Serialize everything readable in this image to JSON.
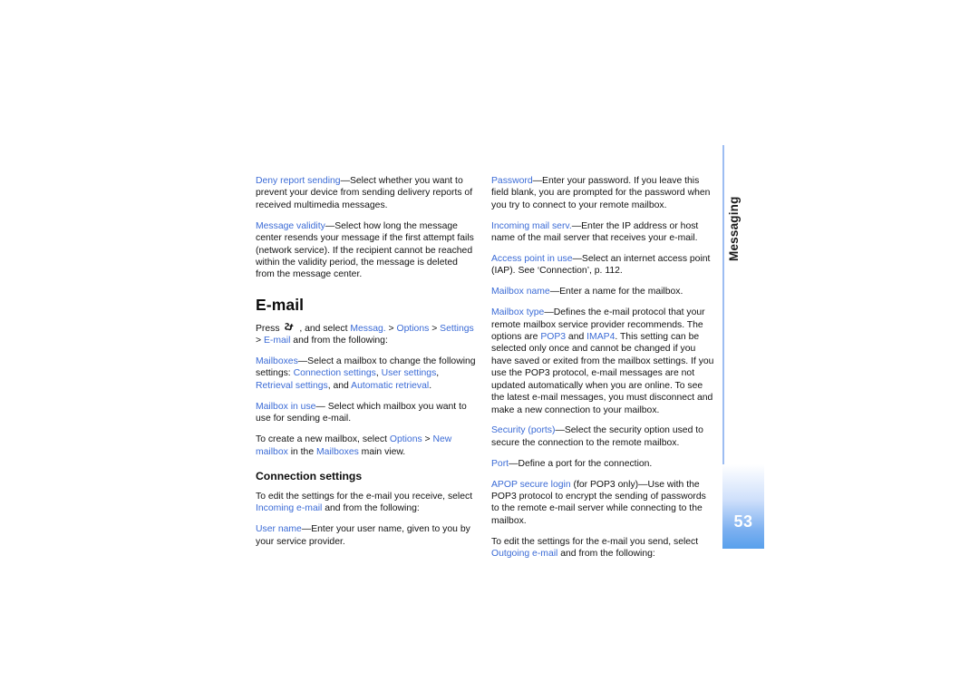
{
  "page": {
    "number": "53",
    "chapter_label": "Messaging",
    "accent_color": "#3b6bd6",
    "tab_color": "#58a0ec"
  },
  "left_column": {
    "paragraphs": [
      {
        "id": "deny-report-sending",
        "runs": [
          {
            "text": "Deny report sending",
            "link": true
          },
          {
            "text": "—Select whether you want to prevent your device from sending delivery reports of received multimedia messages.",
            "link": false
          }
        ]
      },
      {
        "id": "message-validity",
        "runs": [
          {
            "text": "Message validity",
            "link": true
          },
          {
            "text": "—Select how long the message center resends your message if the first attempt fails (network service). If the recipient cannot be reached within the validity period, the message is deleted from the message center.",
            "link": false
          }
        ]
      }
    ],
    "section_title": "E-mail",
    "after_title_paragraphs": [
      {
        "id": "press-path",
        "icon": "menu-key-icon",
        "runs": [
          {
            "text": "Press ",
            "link": false
          },
          {
            "icon": "menu-key-icon"
          },
          {
            "text": " , and select ",
            "link": false
          },
          {
            "text": "Messag.",
            "link": true
          },
          {
            "text": " > ",
            "link": false
          },
          {
            "text": "Options",
            "link": true
          },
          {
            "text": " > ",
            "link": false
          },
          {
            "text": "Settings",
            "link": true
          },
          {
            "text": " > ",
            "link": false
          },
          {
            "text": "E-mail",
            "link": true
          },
          {
            "text": " and from the following:",
            "link": false
          }
        ]
      },
      {
        "id": "mailboxes",
        "runs": [
          {
            "text": "Mailboxes",
            "link": true
          },
          {
            "text": "—Select a mailbox to change the following settings: ",
            "link": false
          },
          {
            "text": "Connection settings",
            "link": true
          },
          {
            "text": ", ",
            "link": false
          },
          {
            "text": "User settings",
            "link": true
          },
          {
            "text": ", ",
            "link": false
          },
          {
            "text": "Retrieval settings",
            "link": true
          },
          {
            "text": ", and ",
            "link": false
          },
          {
            "text": "Automatic retrieval",
            "link": true
          },
          {
            "text": ".",
            "link": false
          }
        ]
      },
      {
        "id": "mailbox-in-use",
        "runs": [
          {
            "text": "Mailbox in use",
            "link": true
          },
          {
            "text": "— Select which mailbox you want to use for sending e-mail.",
            "link": false
          }
        ]
      },
      {
        "id": "create-new-mailbox",
        "runs": [
          {
            "text": "To create a new mailbox, select ",
            "link": false
          },
          {
            "text": "Options",
            "link": true
          },
          {
            "text": " > ",
            "link": false
          },
          {
            "text": "New mailbox",
            "link": true
          },
          {
            "text": " in the ",
            "link": false
          },
          {
            "text": "Mailboxes",
            "link": true
          },
          {
            "text": " main view.",
            "link": false
          }
        ]
      }
    ],
    "sub_title": "Connection settings",
    "after_sub_paragraphs": [
      {
        "id": "incoming-email-intro",
        "runs": [
          {
            "text": "To edit the settings for the e-mail you receive, select ",
            "link": false
          },
          {
            "text": "Incoming e-mail",
            "link": true
          },
          {
            "text": " and from the following:",
            "link": false
          }
        ]
      },
      {
        "id": "user-name",
        "runs": [
          {
            "text": "User name",
            "link": true
          },
          {
            "text": "—Enter your user name, given to you by your service provider.",
            "link": false
          }
        ]
      }
    ]
  },
  "right_column": {
    "paragraphs": [
      {
        "id": "password",
        "runs": [
          {
            "text": "Password",
            "link": true
          },
          {
            "text": "—Enter your password. If you leave this field blank, you are prompted for the password when you try to connect to your remote mailbox.",
            "link": false
          }
        ]
      },
      {
        "id": "incoming-mail-serv",
        "runs": [
          {
            "text": "Incoming mail serv.",
            "link": true
          },
          {
            "text": "—Enter the IP address or host name of the mail server that receives your e-mail.",
            "link": false
          }
        ]
      },
      {
        "id": "access-point-in-use",
        "runs": [
          {
            "text": "Access point in use",
            "link": true
          },
          {
            "text": "—Select an internet access point (IAP). See ‘Connection’, p. 112.",
            "link": false
          }
        ]
      },
      {
        "id": "mailbox-name",
        "runs": [
          {
            "text": "Mailbox name",
            "link": true
          },
          {
            "text": "—Enter a name for the mailbox.",
            "link": false
          }
        ]
      },
      {
        "id": "mailbox-type",
        "runs": [
          {
            "text": "Mailbox type",
            "link": true
          },
          {
            "text": "—Defines the e-mail protocol that your remote mailbox service provider recommends. The options are ",
            "link": false
          },
          {
            "text": "POP3",
            "link": true
          },
          {
            "text": " and ",
            "link": false
          },
          {
            "text": "IMAP4",
            "link": true
          },
          {
            "text": ". This setting can be selected only once and cannot be changed if you have saved or exited from the mailbox settings. If you use the POP3 protocol, e-mail messages are not updated automatically when you are online. To see the latest e-mail messages, you must disconnect and make a new connection to your mailbox.",
            "link": false
          }
        ]
      },
      {
        "id": "security-ports",
        "runs": [
          {
            "text": "Security (ports)",
            "link": true
          },
          {
            "text": "—Select the security option used to secure the connection to the remote mailbox.",
            "link": false
          }
        ]
      },
      {
        "id": "port",
        "runs": [
          {
            "text": "Port",
            "link": true
          },
          {
            "text": "—Define a port for the connection.",
            "link": false
          }
        ]
      },
      {
        "id": "apop-secure-login",
        "runs": [
          {
            "text": "APOP secure login",
            "link": true
          },
          {
            "text": " (for POP3 only)—Use with the POP3 protocol to encrypt the sending of passwords to the remote e-mail server while connecting to the mailbox.",
            "link": false
          }
        ]
      },
      {
        "id": "outgoing-email-intro",
        "runs": [
          {
            "text": "To edit the settings for the e-mail you send, select ",
            "link": false
          },
          {
            "text": "Outgoing e-mail",
            "link": true
          },
          {
            "text": " and from the following:",
            "link": false
          }
        ]
      }
    ]
  }
}
